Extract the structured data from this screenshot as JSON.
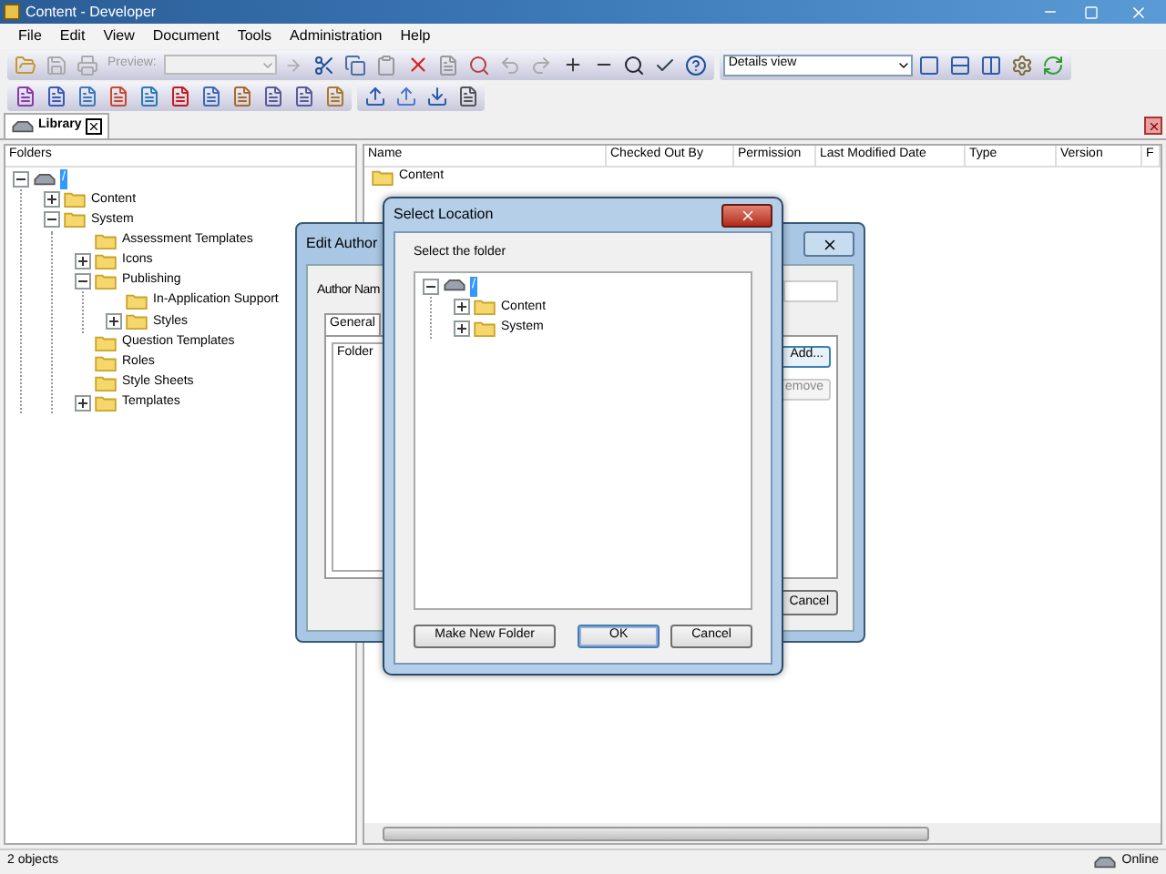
{
  "window": {
    "title": "Content - Developer"
  },
  "menu": [
    "File",
    "Edit",
    "View",
    "Document",
    "Tools",
    "Administration",
    "Help"
  ],
  "toolbar": {
    "preview_label": "Preview:",
    "view_select": "Details view"
  },
  "tabs": [
    {
      "label": "Library",
      "selected": true
    }
  ],
  "folders": {
    "header": "Folders",
    "tree": [
      {
        "label": "/",
        "expanded": true,
        "selected": true,
        "kind": "root",
        "children": [
          {
            "label": "Content",
            "expanded": false,
            "selected": false
          },
          {
            "label": "System",
            "expanded": true,
            "selected": false,
            "children": [
              {
                "label": "Assessment Templates",
                "selected": false
              },
              {
                "label": "Icons",
                "expanded": false,
                "selected": false
              },
              {
                "label": "Publishing",
                "expanded": true,
                "selected": false,
                "children": [
                  {
                    "label": "In-Application Support",
                    "selected": false
                  },
                  {
                    "label": "Styles",
                    "expanded": false,
                    "selected": false
                  }
                ]
              },
              {
                "label": "Question Templates",
                "selected": false
              },
              {
                "label": "Roles",
                "selected": false
              },
              {
                "label": "Style Sheets",
                "selected": false
              },
              {
                "label": "Templates",
                "expanded": false,
                "selected": false
              }
            ]
          }
        ]
      }
    ]
  },
  "list": {
    "columns": [
      "Name",
      "Checked Out By",
      "Permission",
      "Last Modified Date",
      "Type",
      "Version",
      "F"
    ],
    "rows": [
      "Content"
    ]
  },
  "edit_author": {
    "title": "Edit Author",
    "author_label": "Author Nam",
    "tabs": [
      {
        "label": "General",
        "selected": true
      }
    ],
    "folder_column": "Folder",
    "buttons": [
      {
        "label": "Add...",
        "disabled": false
      },
      {
        "label": "emove",
        "disabled": true
      },
      {
        "label": "Cancel",
        "disabled": false
      }
    ]
  },
  "select_location": {
    "title": "Select Location",
    "prompt": "Select the folder",
    "tree": [
      {
        "label": "/",
        "expanded": true,
        "selected": true,
        "kind": "root",
        "children": [
          {
            "label": "Content",
            "expanded": false,
            "selected": false
          },
          {
            "label": "System",
            "expanded": false,
            "selected": false
          }
        ]
      }
    ],
    "buttons": [
      {
        "label": "Make New Folder",
        "default": false
      },
      {
        "label": "OK",
        "default": true
      },
      {
        "label": "Cancel",
        "default": false
      }
    ]
  },
  "status_bar": {
    "text": "2 objects",
    "connection": "Online"
  }
}
